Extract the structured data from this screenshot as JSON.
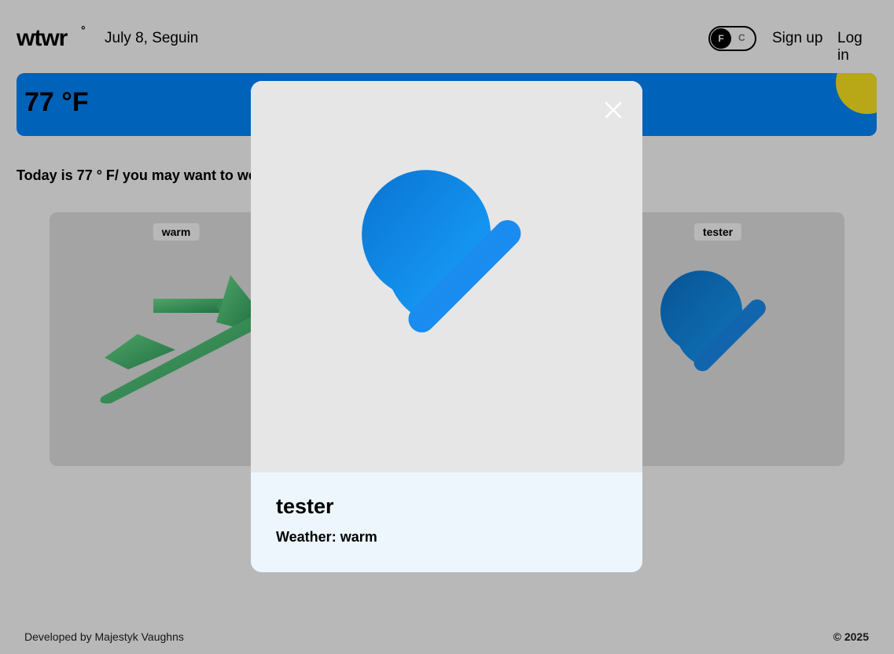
{
  "header": {
    "logo": "wtwr",
    "logo_degree": "°",
    "date_location": "July 8, Seguin",
    "unit_toggle": {
      "active": "F",
      "inactive": "C"
    },
    "signup_label": "Sign up",
    "login_label": "Log in"
  },
  "weather": {
    "temperature": "77 °F",
    "today_text": "Today is 77 ° F/ you may want to we",
    "colors": {
      "banner": "#0088ff",
      "sun": "#ffe81f"
    }
  },
  "cards": [
    {
      "tag": "warm",
      "icon": "sandal-icon"
    },
    {
      "tag": "tester",
      "icon": "beanie-hat-icon"
    }
  ],
  "modal": {
    "title": "tester",
    "weather_label": "Weather:",
    "weather_value": "warm",
    "icon": "beanie-hat-icon",
    "close_icon": "close-icon"
  },
  "footer": {
    "credit": "Developed by Majestyk Vaughns",
    "copyright": "© 2025"
  }
}
